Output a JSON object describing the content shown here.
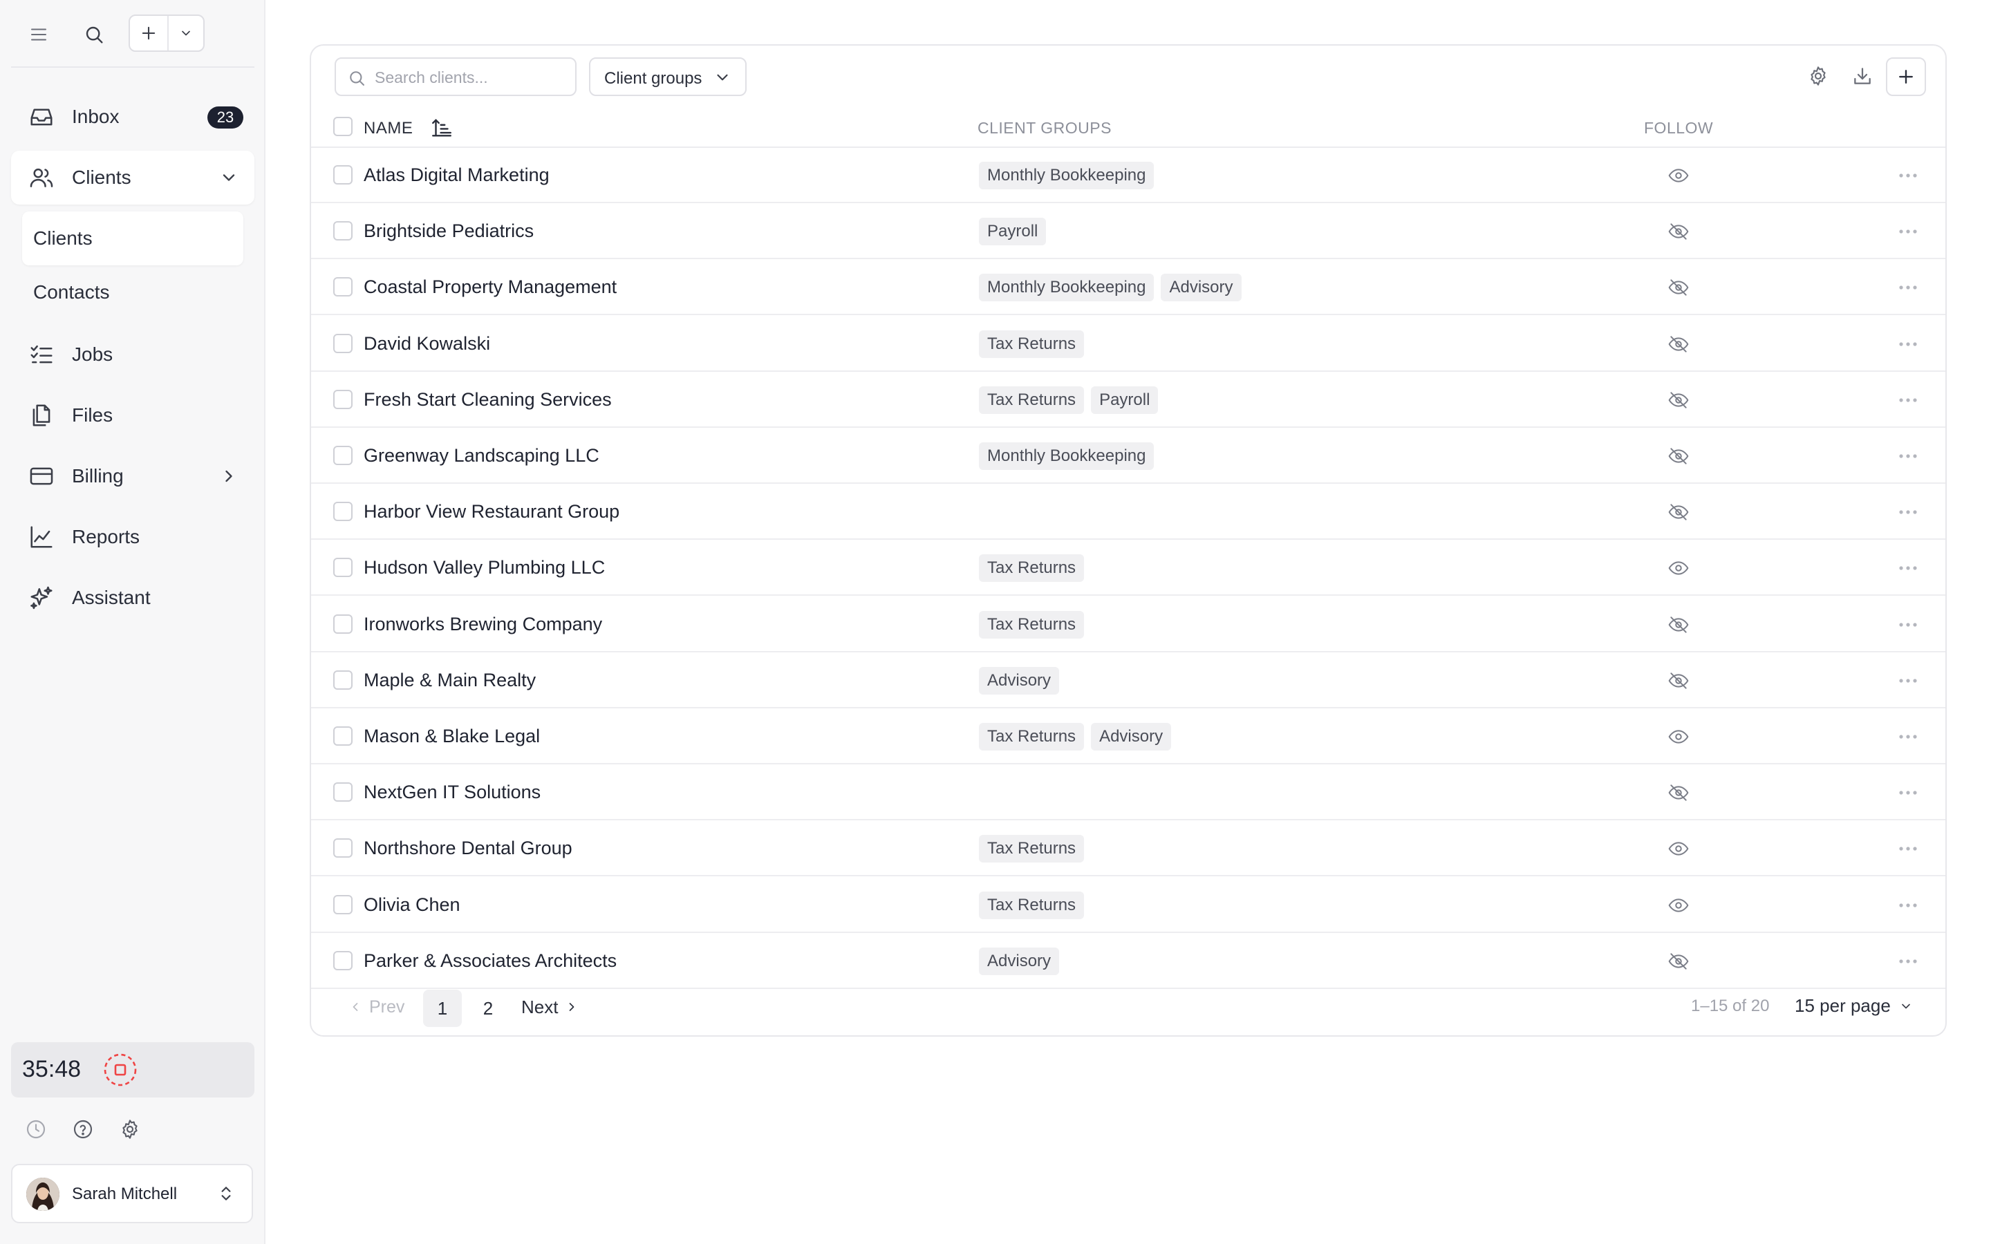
{
  "sidebar": {
    "nav": {
      "inbox": {
        "label": "Inbox",
        "badge": "23"
      },
      "clients": {
        "label": "Clients"
      },
      "clients_sub": {
        "clients": "Clients",
        "contacts": "Contacts"
      },
      "jobs": {
        "label": "Jobs"
      },
      "files": {
        "label": "Files"
      },
      "billing": {
        "label": "Billing"
      },
      "reports": {
        "label": "Reports"
      },
      "assistant": {
        "label": "Assistant"
      }
    },
    "timer": {
      "time": "35:48",
      "record_color": "#ef4444"
    },
    "user": {
      "name": "Sarah Mitchell"
    }
  },
  "toolbar": {
    "search_placeholder": "Search clients...",
    "groups_label": "Client groups"
  },
  "table": {
    "headers": {
      "name": "NAME",
      "groups": "CLIENT GROUPS",
      "follow": "FOLLOW"
    },
    "rows": [
      {
        "name": "Atlas Digital Marketing",
        "groups": [
          "Monthly Bookkeeping"
        ],
        "following": true
      },
      {
        "name": "Brightside Pediatrics",
        "groups": [
          "Payroll"
        ],
        "following": false
      },
      {
        "name": "Coastal Property Management",
        "groups": [
          "Monthly Bookkeeping",
          "Advisory"
        ],
        "following": false
      },
      {
        "name": "David Kowalski",
        "groups": [
          "Tax Returns"
        ],
        "following": false
      },
      {
        "name": "Fresh Start Cleaning Services",
        "groups": [
          "Tax Returns",
          "Payroll"
        ],
        "following": false
      },
      {
        "name": "Greenway Landscaping LLC",
        "groups": [
          "Monthly Bookkeeping"
        ],
        "following": false
      },
      {
        "name": "Harbor View Restaurant Group",
        "groups": [],
        "following": false
      },
      {
        "name": "Hudson Valley Plumbing LLC",
        "groups": [
          "Tax Returns"
        ],
        "following": true
      },
      {
        "name": "Ironworks Brewing Company",
        "groups": [
          "Tax Returns"
        ],
        "following": false
      },
      {
        "name": "Maple & Main Realty",
        "groups": [
          "Advisory"
        ],
        "following": false
      },
      {
        "name": "Mason & Blake Legal",
        "groups": [
          "Tax Returns",
          "Advisory"
        ],
        "following": true
      },
      {
        "name": "NextGen IT Solutions",
        "groups": [],
        "following": false
      },
      {
        "name": "Northshore Dental Group",
        "groups": [
          "Tax Returns"
        ],
        "following": true
      },
      {
        "name": "Olivia Chen",
        "groups": [
          "Tax Returns"
        ],
        "following": true
      },
      {
        "name": "Parker & Associates Architects",
        "groups": [
          "Advisory"
        ],
        "following": false
      }
    ]
  },
  "pagination": {
    "prev": "Prev",
    "pages": [
      "1",
      "2"
    ],
    "current": "1",
    "next": "Next",
    "range": "1–15 of 20",
    "per_page": "15 per page"
  }
}
